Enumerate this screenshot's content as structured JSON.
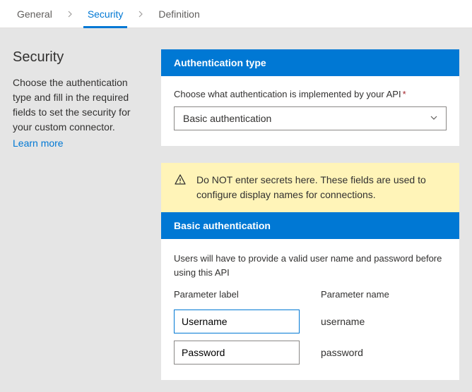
{
  "tabs": {
    "general": "General",
    "security": "Security",
    "definition": "Definition"
  },
  "left": {
    "title": "Security",
    "desc": "Choose the authentication type and fill in the required fields to set the security for your custom connector.",
    "learn_more": "Learn more"
  },
  "auth_type": {
    "header": "Authentication type",
    "label": "Choose what authentication is implemented by your API",
    "required_mark": "*",
    "selected": "Basic authentication"
  },
  "warning": "Do NOT enter secrets here. These fields are used to configure display names for connections.",
  "basic": {
    "header": "Basic authentication",
    "desc": "Users will have to provide a valid user name and password before using this API",
    "col_label": "Parameter label",
    "col_name": "Parameter name",
    "rows": [
      {
        "label": "Username",
        "name": "username"
      },
      {
        "label": "Password",
        "name": "password"
      }
    ]
  }
}
